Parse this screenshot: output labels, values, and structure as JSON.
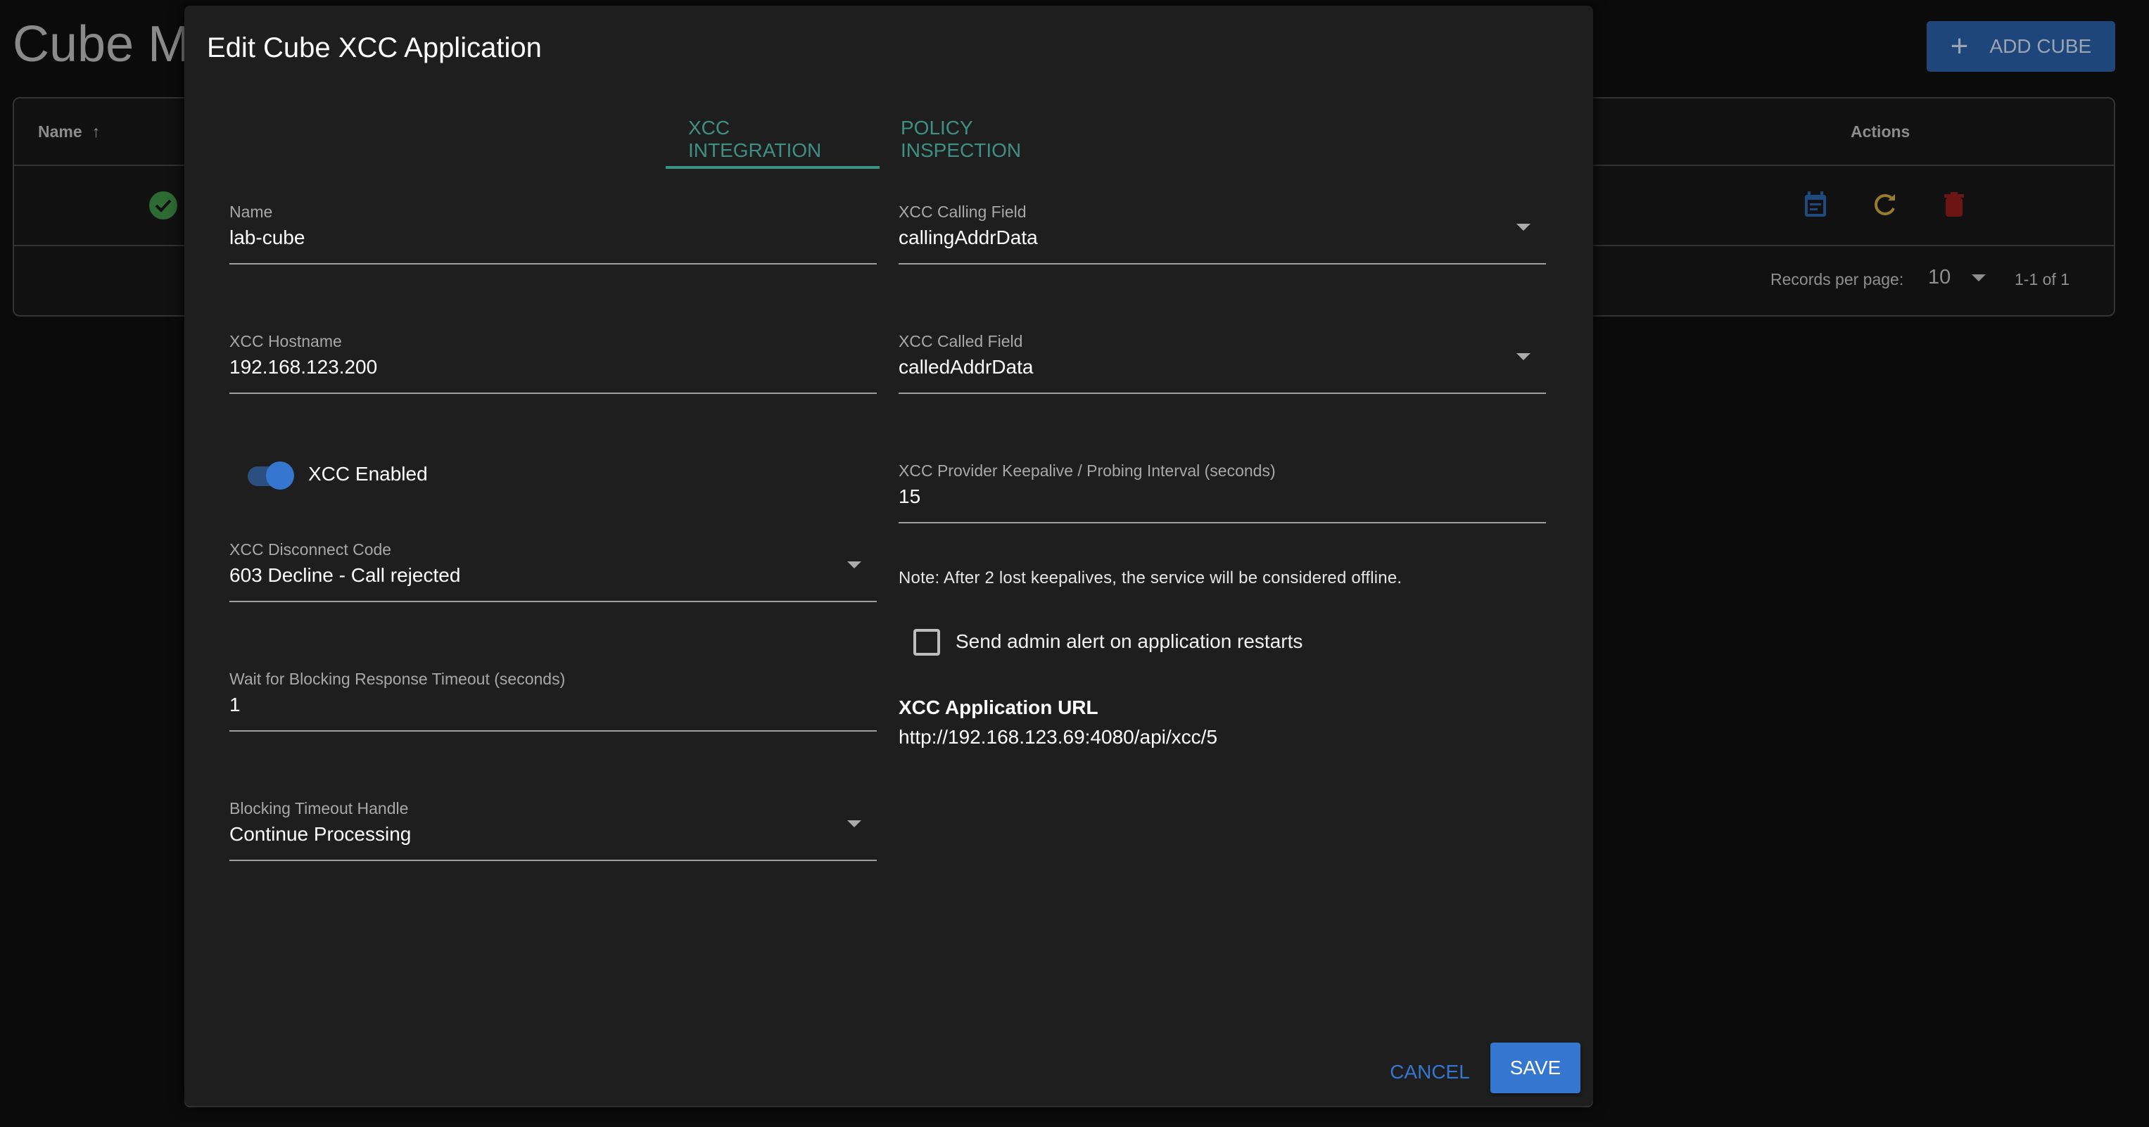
{
  "page": {
    "title": "Cube Ma",
    "add_button_label": "ADD CUBE",
    "table": {
      "columns": {
        "name": "Name",
        "actions": "Actions"
      },
      "sort_indicator": "↑",
      "rows": [
        {
          "status": "ok",
          "actions": [
            "edit-calendar",
            "refresh",
            "delete"
          ]
        }
      ],
      "footer": {
        "records_per_page_label": "Records per page:",
        "records_per_page_value": "10",
        "range": "1-1 of 1"
      }
    }
  },
  "dialog": {
    "title": "Edit Cube XCC Application",
    "tabs": [
      {
        "label": "XCC INTEGRATION",
        "active": true
      },
      {
        "label": "POLICY INSPECTION",
        "active": false
      }
    ],
    "left": {
      "name": {
        "label": "Name",
        "value": "lab-cube"
      },
      "hostname": {
        "label": "XCC Hostname",
        "value": "192.168.123.200"
      },
      "enabled": {
        "label": "XCC Enabled",
        "checked": true
      },
      "disconnect_code": {
        "label": "XCC Disconnect Code",
        "value": "603 Decline - Call rejected"
      },
      "blocking_timeout": {
        "label": "Wait for Blocking Response Timeout (seconds)",
        "value": "1"
      },
      "timeout_handle": {
        "label": "Blocking Timeout Handle",
        "value": "Continue Processing"
      }
    },
    "right": {
      "calling_field": {
        "label": "XCC Calling Field",
        "value": "callingAddrData"
      },
      "called_field": {
        "label": "XCC Called Field",
        "value": "calledAddrData"
      },
      "keepalive": {
        "label": "XCC Provider Keepalive / Probing Interval (seconds)",
        "value": "15"
      },
      "note": "Note: After 2 lost keepalives, the service will be considered offline.",
      "admin_alert": {
        "label": "Send admin alert on application restarts",
        "checked": false
      },
      "url_title": "XCC Application URL",
      "url_value": "http://192.168.123.69:4080/api/xcc/5"
    },
    "buttons": {
      "cancel": "CANCEL",
      "save": "SAVE"
    }
  },
  "colors": {
    "accent_teal": "#3d9184",
    "primary_blue": "#3577d0",
    "status_green": "#2e6b33",
    "action_blue": "#1f4a80",
    "action_gold": "#9a7b2e",
    "action_red": "#6b1515"
  }
}
